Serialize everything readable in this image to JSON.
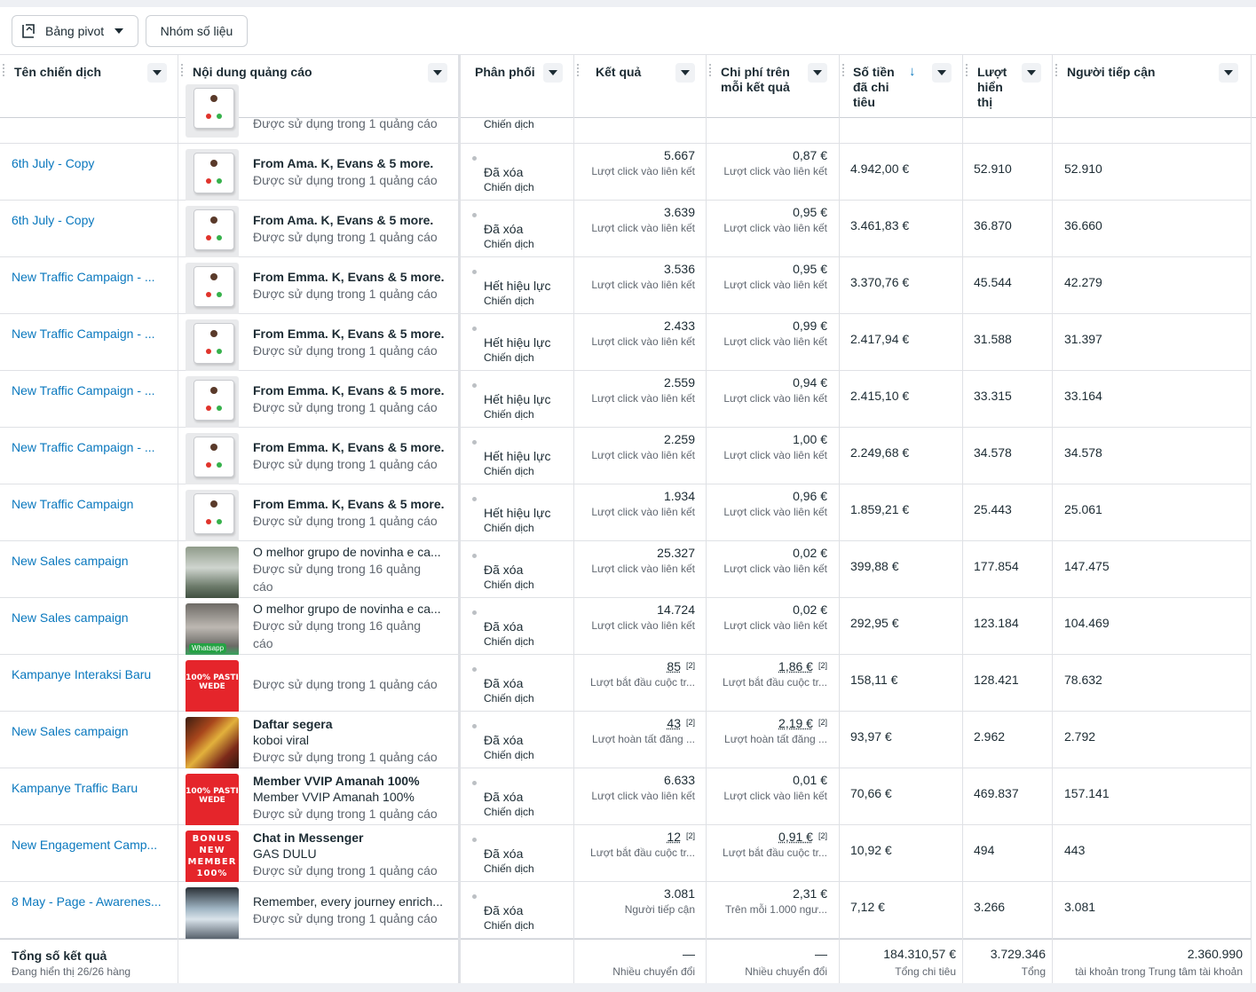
{
  "toolbar": {
    "pivot_label": "Bảng pivot",
    "group_label": "Nhóm số liệu"
  },
  "columns": {
    "campaign": "Tên chiến dịch",
    "ad_content": "Nội dung quảng cáo",
    "delivery": "Phân phối",
    "results": "Kết quả",
    "cost_per_result": [
      "Chi phí trên",
      "mỗi kết quả"
    ],
    "amount_spent": [
      "Số tiền",
      "đã chi",
      "tiêu"
    ],
    "impressions": [
      "Lượt",
      "hiển",
      "thị"
    ],
    "reach": "Người tiếp cận"
  },
  "partial_row": {
    "ad_usage": "Được sử dụng trong 1 quảng cáo",
    "delivery_level": "Chiến dịch"
  },
  "rows": [
    {
      "campaign": "6th July - Copy",
      "ad_title": "From Ama. K, Evans & 5 more.",
      "ad_usage": "Được sử dụng trong 1 quảng cáo",
      "delivery": "Đã xóa",
      "level": "Chiến dịch",
      "results": "5.667",
      "results_type": "Lượt click vào liên kết",
      "cost": "0,87 €",
      "cost_type": "Lượt click vào liên kết",
      "spent": "4.942,00 €",
      "impressions": "52.910",
      "reach": "52.910"
    },
    {
      "campaign": "6th July - Copy",
      "ad_title": "From Ama. K, Evans & 5 more.",
      "ad_usage": "Được sử dụng trong 1 quảng cáo",
      "delivery": "Đã xóa",
      "level": "Chiến dịch",
      "results": "3.639",
      "results_type": "Lượt click vào liên kết",
      "cost": "0,95 €",
      "cost_type": "Lượt click vào liên kết",
      "spent": "3.461,83 €",
      "impressions": "36.870",
      "reach": "36.660"
    },
    {
      "campaign": "New Traffic Campaign - ...",
      "ad_title": "From Emma. K, Evans & 5 more.",
      "ad_usage": "Được sử dụng trong 1 quảng cáo",
      "delivery": "Hết hiệu lực",
      "level": "Chiến dịch",
      "results": "3.536",
      "results_type": "Lượt click vào liên kết",
      "cost": "0,95 €",
      "cost_type": "Lượt click vào liên kết",
      "spent": "3.370,76 €",
      "impressions": "45.544",
      "reach": "42.279"
    },
    {
      "campaign": "New Traffic Campaign - ...",
      "ad_title": "From Emma. K, Evans & 5 more.",
      "ad_usage": "Được sử dụng trong 1 quảng cáo",
      "delivery": "Hết hiệu lực",
      "level": "Chiến dịch",
      "results": "2.433",
      "results_type": "Lượt click vào liên kết",
      "cost": "0,99 €",
      "cost_type": "Lượt click vào liên kết",
      "spent": "2.417,94 €",
      "impressions": "31.588",
      "reach": "31.397"
    },
    {
      "campaign": "New Traffic Campaign - ...",
      "ad_title": "From Emma. K, Evans & 5 more.",
      "ad_usage": "Được sử dụng trong 1 quảng cáo",
      "delivery": "Hết hiệu lực",
      "level": "Chiến dịch",
      "results": "2.559",
      "results_type": "Lượt click vào liên kết",
      "cost": "0,94 €",
      "cost_type": "Lượt click vào liên kết",
      "spent": "2.415,10 €",
      "impressions": "33.315",
      "reach": "33.164"
    },
    {
      "campaign": "New Traffic Campaign - ...",
      "ad_title": "From Emma. K, Evans & 5 more.",
      "ad_usage": "Được sử dụng trong 1 quảng cáo",
      "delivery": "Hết hiệu lực",
      "level": "Chiến dịch",
      "results": "2.259",
      "results_type": "Lượt click vào liên kết",
      "cost": "1,00 €",
      "cost_type": "Lượt click vào liên kết",
      "spent": "2.249,68 €",
      "impressions": "34.578",
      "reach": "34.578"
    },
    {
      "campaign": "New Traffic Campaign",
      "ad_title": "From Emma. K, Evans & 5 more.",
      "ad_usage": "Được sử dụng trong 1 quảng cáo",
      "delivery": "Hết hiệu lực",
      "level": "Chiến dịch",
      "results": "1.934",
      "results_type": "Lượt click vào liên kết",
      "cost": "0,96 €",
      "cost_type": "Lượt click vào liên kết",
      "spent": "1.859,21 €",
      "impressions": "25.443",
      "reach": "25.061"
    },
    {
      "campaign": "New Sales campaign",
      "ad_title": "O melhor grupo de novinha e ca...",
      "ad_usage": "Được sử dụng trong 16 quảng",
      "ad_usage2": "cáo",
      "delivery": "Đã xóa",
      "level": "Chiến dịch",
      "results": "25.327",
      "results_type": "Lượt click vào liên kết",
      "cost": "0,02 €",
      "cost_type": "Lượt click vào liên kết",
      "spent": "399,88 €",
      "impressions": "177.854",
      "reach": "147.475"
    },
    {
      "campaign": "New Sales campaign",
      "ad_title": "O melhor grupo de novinha e ca...",
      "ad_usage": "Được sử dụng trong 16 quảng",
      "ad_usage2": "cáo",
      "delivery": "Đã xóa",
      "level": "Chiến dịch",
      "results": "14.724",
      "results_type": "Lượt click vào liên kết",
      "cost": "0,02 €",
      "cost_type": "Lượt click vào liên kết",
      "spent": "292,95 €",
      "impressions": "123.184",
      "reach": "104.469"
    },
    {
      "campaign": "Kampanye Interaksi Baru",
      "ad_usage": "Được sử dụng trong 1 quảng cáo",
      "delivery": "Đã xóa",
      "level": "Chiến dịch",
      "results": "85",
      "results_note": "[2]",
      "results_type": "Lượt bắt đầu cuộc tr...",
      "cost": "1,86 €",
      "cost_note": "[2]",
      "cost_type": "Lượt bắt đầu cuộc tr...",
      "spent": "158,11 €",
      "impressions": "128.421",
      "reach": "78.632"
    },
    {
      "campaign": "New Sales campaign",
      "ad_title": "Daftar segera",
      "ad_subtitle": "koboi viral",
      "ad_usage": "Được sử dụng trong 1 quảng cáo",
      "delivery": "Đã xóa",
      "level": "Chiến dịch",
      "results": "43",
      "results_note": "[2]",
      "results_type": "Lượt hoàn tất đăng ...",
      "cost": "2,19 €",
      "cost_note": "[2]",
      "cost_type": "Lượt hoàn tất đăng ...",
      "spent": "93,97 €",
      "impressions": "2.962",
      "reach": "2.792"
    },
    {
      "campaign": "Kampanye Traffic Baru",
      "ad_title": "Member VVIP Amanah 100%",
      "ad_subtitle": "Member VVIP Amanah 100%",
      "ad_usage": "Được sử dụng trong 1 quảng cáo",
      "delivery": "Đã xóa",
      "level": "Chiến dịch",
      "results": "6.633",
      "results_type": "Lượt click vào liên kết",
      "cost": "0,01 €",
      "cost_type": "Lượt click vào liên kết",
      "spent": "70,66 €",
      "impressions": "469.837",
      "reach": "157.141"
    },
    {
      "campaign": "New Engagement Camp...",
      "ad_title": "Chat in Messenger",
      "ad_subtitle": "GAS DULU",
      "ad_usage": "Được sử dụng trong 1 quảng cáo",
      "delivery": "Đã xóa",
      "level": "Chiến dịch",
      "results": "12",
      "results_note": "[2]",
      "results_type": "Lượt bắt đầu cuộc tr...",
      "cost": "0,91 €",
      "cost_note": "[2]",
      "cost_type": "Lượt bắt đầu cuộc tr...",
      "spent": "10,92 €",
      "impressions": "494",
      "reach": "443"
    },
    {
      "campaign": "8 May - Page - Awarenes...",
      "ad_title": "Remember, every journey enrich...",
      "ad_usage": "Được sử dụng trong 1 quảng cáo",
      "delivery": "Đã xóa",
      "level": "Chiến dịch",
      "results": "3.081",
      "results_type": "Người tiếp cận",
      "cost": "2,31 €",
      "cost_type": "Trên mỗi 1.000 ngư...",
      "spent": "7,12 €",
      "impressions": "3.266",
      "reach": "3.081"
    }
  ],
  "thumb_text": {
    "pasti": "100% PASTI WEDE",
    "bonus": "BONUS NEW MEMBER 100%",
    "whatsapp": "Whatsapp"
  },
  "footer": {
    "title": "Tổng số kết quả",
    "rows_shown": "Đang hiển thị 26/26 hàng",
    "results_dash": "—",
    "results_note": "Nhiều chuyển đổi",
    "cost_dash": "—",
    "cost_note": "Nhiều chuyển đổi",
    "spent": "184.310,57 €",
    "spent_note": "Tổng chi tiêu",
    "impressions": "3.729.346",
    "impressions_note": "Tổng",
    "reach": "2.360.990",
    "reach_note": "tài khoản trong Trung tâm tài khoản"
  },
  "colors": {
    "link": "#0a78be",
    "text": "#1c2b33",
    "muted": "#606770",
    "border": "#dfe1e5"
  }
}
